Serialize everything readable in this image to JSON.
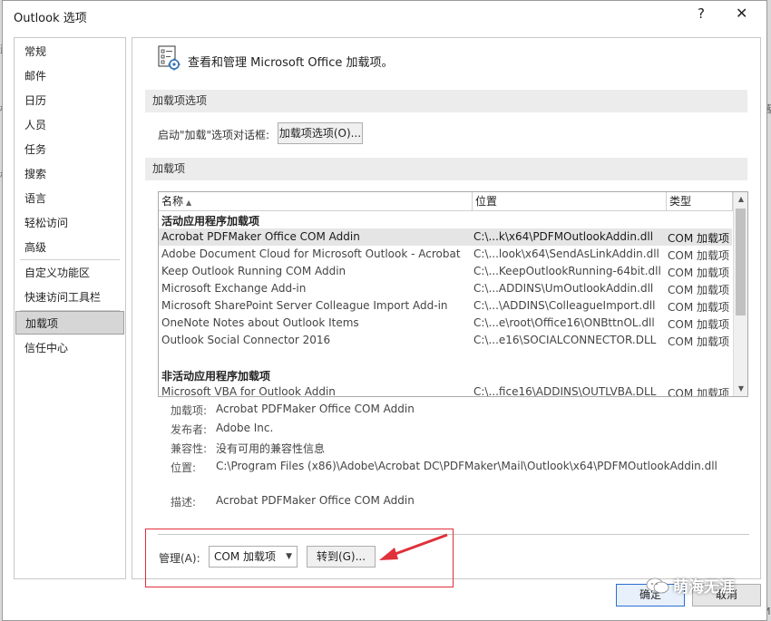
{
  "dialog": {
    "title": "Outlook 选项",
    "help": "?",
    "close": "✕"
  },
  "nav": {
    "items": [
      {
        "label": "常规"
      },
      {
        "label": "邮件"
      },
      {
        "label": "日历"
      },
      {
        "label": "人员"
      },
      {
        "label": "任务"
      },
      {
        "label": "搜索"
      },
      {
        "label": "语言"
      },
      {
        "label": "轻松访问"
      },
      {
        "label": "高级"
      },
      {
        "label": "自定义功能区"
      },
      {
        "label": "快速访问工具栏"
      },
      {
        "label": "加载项"
      },
      {
        "label": "信任中心"
      }
    ],
    "selected": "加载项"
  },
  "header": {
    "text": "查看和管理 Microsoft Office 加载项。"
  },
  "addin_options": {
    "section_title": "加载项选项",
    "prompt": "启动\"加载\"选项对话框:",
    "button": "加载项选项(O)..."
  },
  "addins": {
    "section_title": "加载项",
    "columns": {
      "name": "名称",
      "location": "位置",
      "type": "类型"
    },
    "active_heading": "活动应用程序加载项",
    "active": [
      {
        "name": "Acrobat PDFMaker Office COM Addin",
        "location": "C:\\...k\\x64\\PDFMOutlookAddin.dll",
        "type": "COM 加载项"
      },
      {
        "name": "Adobe Document Cloud for Microsoft Outlook - Acrobat",
        "location": "C:\\...look\\x64\\SendAsLinkAddin.dll",
        "type": "COM 加载项"
      },
      {
        "name": "Keep Outlook Running COM Addin",
        "location": "C:\\...KeepOutlookRunning-64bit.dll",
        "type": "COM 加载项"
      },
      {
        "name": "Microsoft Exchange Add-in",
        "location": "C:\\...ADDINS\\UmOutlookAddin.dll",
        "type": "COM 加载项"
      },
      {
        "name": "Microsoft SharePoint Server Colleague Import Add-in",
        "location": "C:\\...\\ADDINS\\ColleagueImport.dll",
        "type": "COM 加载项"
      },
      {
        "name": "OneNote Notes about Outlook Items",
        "location": "C:\\...e\\root\\Office16\\ONBttnOL.dll",
        "type": "COM 加载项"
      },
      {
        "name": "Outlook Social Connector 2016",
        "location": "C:\\...e16\\SOCIALCONNECTOR.DLL",
        "type": "COM 加载项"
      }
    ],
    "inactive_heading": "非活动应用程序加载项",
    "inactive": [
      {
        "name": "Microsoft VBA for Outlook Addin",
        "location": "C:\\...fice16\\ADDINS\\OUTLVBA.DLL",
        "type": "COM 加载项"
      }
    ]
  },
  "details": {
    "addin_label": "加载项:",
    "addin": "Acrobat PDFMaker Office COM Addin",
    "publisher_label": "发布者:",
    "publisher": "Adobe Inc.",
    "compat_label": "兼容性:",
    "compat": "没有可用的兼容性信息",
    "location_label": "位置:",
    "location": "C:\\Program Files (x86)\\Adobe\\Acrobat DC\\PDFMaker\\Mail\\Outlook\\x64\\PDFMOutlookAddin.dll",
    "desc_label": "描述:",
    "desc": "Acrobat PDFMaker Office COM Addin"
  },
  "manage": {
    "label": "管理(A):",
    "selected": "COM 加载项",
    "go_button": "转到(G)..."
  },
  "footer": {
    "ok": "确定",
    "cancel": "取消"
  },
  "watermark": {
    "text": "萌海无涯"
  },
  "background": {
    "left_chars": [
      "建",
      "标",
      "栈"
    ],
    "right_chars": [
      "落",
      "Mi"
    ]
  },
  "colors": {
    "annotation": "#e0303a",
    "selection": "#d6d6d6"
  }
}
